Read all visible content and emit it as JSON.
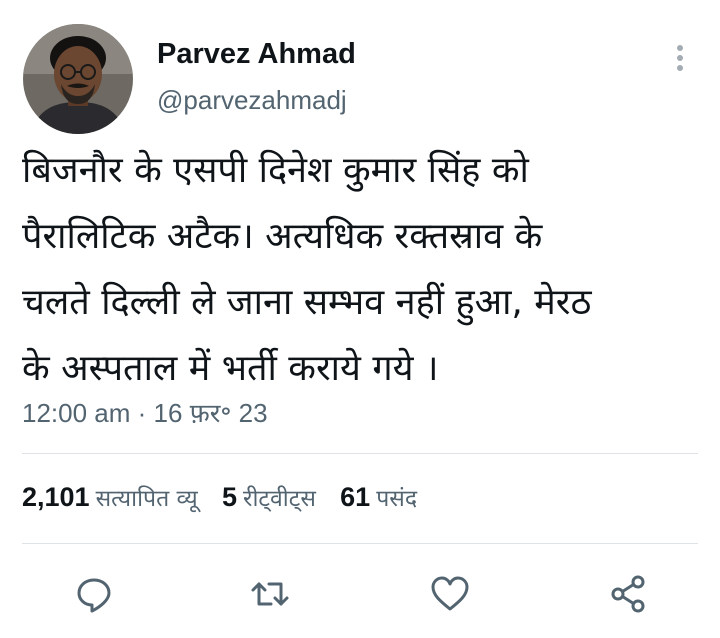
{
  "author": {
    "name": "Parvez Ahmad",
    "handle": "@parvezahmadj"
  },
  "tweet": {
    "text": "बिजनौर के एसपी दिनेश कुमार सिंह को\nपैरालिटिक अटैक। अत्यधिक रक्तस्राव के\nचलते दिल्ली ले जाना सम्भव नहीं हुआ, मेरठ\nके अस्पताल में भर्ती कराये गये ।",
    "time": "12:00 am",
    "separator": "·",
    "date": "16 फ़र॰ 23"
  },
  "stats": {
    "views_count": "2,101",
    "views_label": "सत्यापित व्यू",
    "retweets_count": "5",
    "retweets_label": "रीट्वीट्स",
    "likes_count": "61",
    "likes_label": "पसंद"
  },
  "icons": {
    "more": "more-vertical-icon",
    "reply": "reply-icon",
    "retweet": "retweet-icon",
    "like": "heart-icon",
    "share": "share-icon"
  },
  "colors": {
    "text_primary": "#0f1419",
    "text_secondary": "#536471",
    "divider": "#dfe3e6",
    "icon": "#536471"
  }
}
